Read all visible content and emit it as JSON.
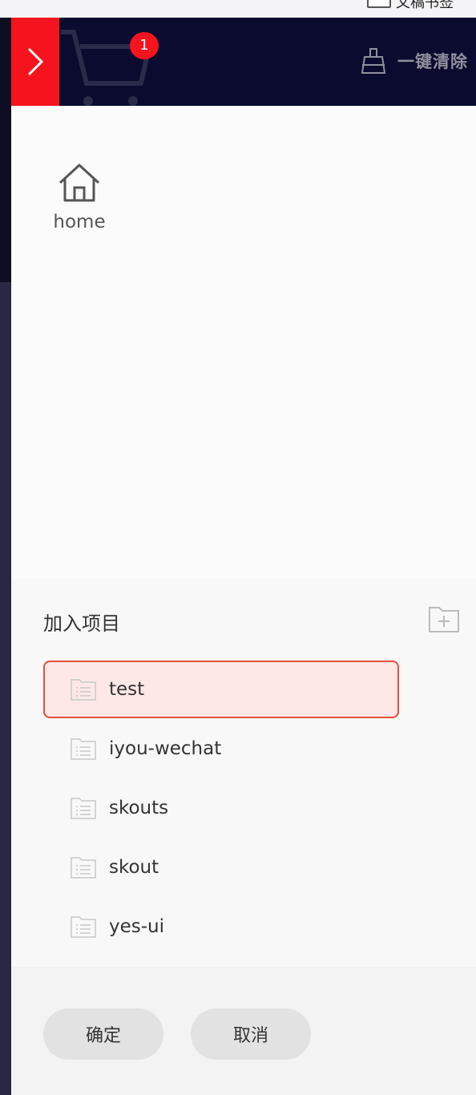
{
  "topstrip": {
    "text": "文稿书签"
  },
  "header": {
    "cart_badge": "1",
    "clear_label": "一键清除"
  },
  "home": {
    "label": "home"
  },
  "projects": {
    "title": "加入项目",
    "items": [
      {
        "name": "test",
        "selected": true
      },
      {
        "name": "iyou-wechat",
        "selected": false
      },
      {
        "name": "skouts",
        "selected": false
      },
      {
        "name": "skout",
        "selected": false
      },
      {
        "name": "yes-ui",
        "selected": false
      }
    ]
  },
  "footer": {
    "confirm_label": "确定",
    "cancel_label": "取消"
  },
  "colors": {
    "header_bg": "#0a0b2e",
    "accent_red": "#f5141e",
    "selected_bg": "#fde8e7",
    "selected_border": "#e0513d"
  }
}
